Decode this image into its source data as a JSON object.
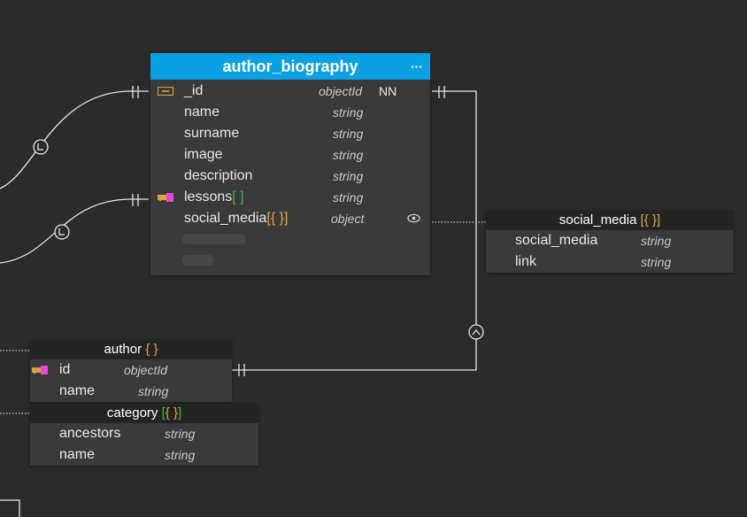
{
  "entities": {
    "author_biography": {
      "title": "author_biography",
      "menu_label": "···",
      "fields": [
        {
          "name": "_id",
          "type": "objectId",
          "nn": "NN"
        },
        {
          "name": "name",
          "type": "string"
        },
        {
          "name": "surname",
          "type": "string"
        },
        {
          "name": "image",
          "type": "string"
        },
        {
          "name": "description",
          "type": "string"
        },
        {
          "name": "lessons",
          "bracket": "[ ]",
          "type": "string"
        },
        {
          "name": "social_media",
          "bracket": "[{ }]",
          "type": "object"
        }
      ]
    },
    "social_media": {
      "title": "social_media",
      "bracket": "[{ }]",
      "fields": [
        {
          "name": "social_media",
          "type": "string"
        },
        {
          "name": "link",
          "type": "string"
        }
      ]
    },
    "author": {
      "title": "author",
      "bracket": "{ }",
      "fields": [
        {
          "name": "id",
          "type": "objectId"
        },
        {
          "name": "name",
          "type": "string"
        }
      ]
    },
    "category": {
      "title": "category",
      "bracket": "[{ }]",
      "fields": [
        {
          "name": "ancestors",
          "type": "string"
        },
        {
          "name": "name",
          "type": "string"
        }
      ]
    }
  },
  "colors": {
    "canvas": "#2b2b2b",
    "header_accent": "#0aa0e3",
    "entity_body": "#3a3a3a",
    "bracket_orange": "#e9a43b",
    "bracket_green": "#42b94c",
    "key_icon": "#e54ad6",
    "wire": "#e6e6e6"
  },
  "icons": {
    "id_field": "id-field-icon",
    "foreign_key": "key-icon",
    "visibility": "eye-icon",
    "relation_marker": "relation-direction-icon"
  }
}
